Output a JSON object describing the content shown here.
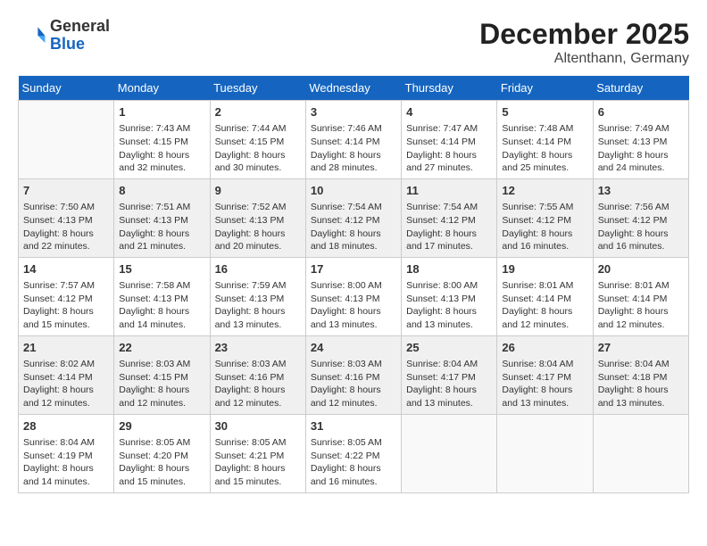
{
  "header": {
    "logo_general": "General",
    "logo_blue": "Blue",
    "month": "December 2025",
    "location": "Altenthann, Germany"
  },
  "days_of_week": [
    "Sunday",
    "Monday",
    "Tuesday",
    "Wednesday",
    "Thursday",
    "Friday",
    "Saturday"
  ],
  "weeks": [
    [
      {
        "day": "",
        "data": ""
      },
      {
        "day": "1",
        "sunrise": "Sunrise: 7:43 AM",
        "sunset": "Sunset: 4:15 PM",
        "daylight": "Daylight: 8 hours and 32 minutes."
      },
      {
        "day": "2",
        "sunrise": "Sunrise: 7:44 AM",
        "sunset": "Sunset: 4:15 PM",
        "daylight": "Daylight: 8 hours and 30 minutes."
      },
      {
        "day": "3",
        "sunrise": "Sunrise: 7:46 AM",
        "sunset": "Sunset: 4:14 PM",
        "daylight": "Daylight: 8 hours and 28 minutes."
      },
      {
        "day": "4",
        "sunrise": "Sunrise: 7:47 AM",
        "sunset": "Sunset: 4:14 PM",
        "daylight": "Daylight: 8 hours and 27 minutes."
      },
      {
        "day": "5",
        "sunrise": "Sunrise: 7:48 AM",
        "sunset": "Sunset: 4:14 PM",
        "daylight": "Daylight: 8 hours and 25 minutes."
      },
      {
        "day": "6",
        "sunrise": "Sunrise: 7:49 AM",
        "sunset": "Sunset: 4:13 PM",
        "daylight": "Daylight: 8 hours and 24 minutes."
      }
    ],
    [
      {
        "day": "7",
        "sunrise": "Sunrise: 7:50 AM",
        "sunset": "Sunset: 4:13 PM",
        "daylight": "Daylight: 8 hours and 22 minutes."
      },
      {
        "day": "8",
        "sunrise": "Sunrise: 7:51 AM",
        "sunset": "Sunset: 4:13 PM",
        "daylight": "Daylight: 8 hours and 21 minutes."
      },
      {
        "day": "9",
        "sunrise": "Sunrise: 7:52 AM",
        "sunset": "Sunset: 4:13 PM",
        "daylight": "Daylight: 8 hours and 20 minutes."
      },
      {
        "day": "10",
        "sunrise": "Sunrise: 7:54 AM",
        "sunset": "Sunset: 4:12 PM",
        "daylight": "Daylight: 8 hours and 18 minutes."
      },
      {
        "day": "11",
        "sunrise": "Sunrise: 7:54 AM",
        "sunset": "Sunset: 4:12 PM",
        "daylight": "Daylight: 8 hours and 17 minutes."
      },
      {
        "day": "12",
        "sunrise": "Sunrise: 7:55 AM",
        "sunset": "Sunset: 4:12 PM",
        "daylight": "Daylight: 8 hours and 16 minutes."
      },
      {
        "day": "13",
        "sunrise": "Sunrise: 7:56 AM",
        "sunset": "Sunset: 4:12 PM",
        "daylight": "Daylight: 8 hours and 16 minutes."
      }
    ],
    [
      {
        "day": "14",
        "sunrise": "Sunrise: 7:57 AM",
        "sunset": "Sunset: 4:12 PM",
        "daylight": "Daylight: 8 hours and 15 minutes."
      },
      {
        "day": "15",
        "sunrise": "Sunrise: 7:58 AM",
        "sunset": "Sunset: 4:13 PM",
        "daylight": "Daylight: 8 hours and 14 minutes."
      },
      {
        "day": "16",
        "sunrise": "Sunrise: 7:59 AM",
        "sunset": "Sunset: 4:13 PM",
        "daylight": "Daylight: 8 hours and 13 minutes."
      },
      {
        "day": "17",
        "sunrise": "Sunrise: 8:00 AM",
        "sunset": "Sunset: 4:13 PM",
        "daylight": "Daylight: 8 hours and 13 minutes."
      },
      {
        "day": "18",
        "sunrise": "Sunrise: 8:00 AM",
        "sunset": "Sunset: 4:13 PM",
        "daylight": "Daylight: 8 hours and 13 minutes."
      },
      {
        "day": "19",
        "sunrise": "Sunrise: 8:01 AM",
        "sunset": "Sunset: 4:14 PM",
        "daylight": "Daylight: 8 hours and 12 minutes."
      },
      {
        "day": "20",
        "sunrise": "Sunrise: 8:01 AM",
        "sunset": "Sunset: 4:14 PM",
        "daylight": "Daylight: 8 hours and 12 minutes."
      }
    ],
    [
      {
        "day": "21",
        "sunrise": "Sunrise: 8:02 AM",
        "sunset": "Sunset: 4:14 PM",
        "daylight": "Daylight: 8 hours and 12 minutes."
      },
      {
        "day": "22",
        "sunrise": "Sunrise: 8:03 AM",
        "sunset": "Sunset: 4:15 PM",
        "daylight": "Daylight: 8 hours and 12 minutes."
      },
      {
        "day": "23",
        "sunrise": "Sunrise: 8:03 AM",
        "sunset": "Sunset: 4:16 PM",
        "daylight": "Daylight: 8 hours and 12 minutes."
      },
      {
        "day": "24",
        "sunrise": "Sunrise: 8:03 AM",
        "sunset": "Sunset: 4:16 PM",
        "daylight": "Daylight: 8 hours and 12 minutes."
      },
      {
        "day": "25",
        "sunrise": "Sunrise: 8:04 AM",
        "sunset": "Sunset: 4:17 PM",
        "daylight": "Daylight: 8 hours and 13 minutes."
      },
      {
        "day": "26",
        "sunrise": "Sunrise: 8:04 AM",
        "sunset": "Sunset: 4:17 PM",
        "daylight": "Daylight: 8 hours and 13 minutes."
      },
      {
        "day": "27",
        "sunrise": "Sunrise: 8:04 AM",
        "sunset": "Sunset: 4:18 PM",
        "daylight": "Daylight: 8 hours and 13 minutes."
      }
    ],
    [
      {
        "day": "28",
        "sunrise": "Sunrise: 8:04 AM",
        "sunset": "Sunset: 4:19 PM",
        "daylight": "Daylight: 8 hours and 14 minutes."
      },
      {
        "day": "29",
        "sunrise": "Sunrise: 8:05 AM",
        "sunset": "Sunset: 4:20 PM",
        "daylight": "Daylight: 8 hours and 15 minutes."
      },
      {
        "day": "30",
        "sunrise": "Sunrise: 8:05 AM",
        "sunset": "Sunset: 4:21 PM",
        "daylight": "Daylight: 8 hours and 15 minutes."
      },
      {
        "day": "31",
        "sunrise": "Sunrise: 8:05 AM",
        "sunset": "Sunset: 4:22 PM",
        "daylight": "Daylight: 8 hours and 16 minutes."
      },
      {
        "day": "",
        "data": ""
      },
      {
        "day": "",
        "data": ""
      },
      {
        "day": "",
        "data": ""
      }
    ]
  ]
}
